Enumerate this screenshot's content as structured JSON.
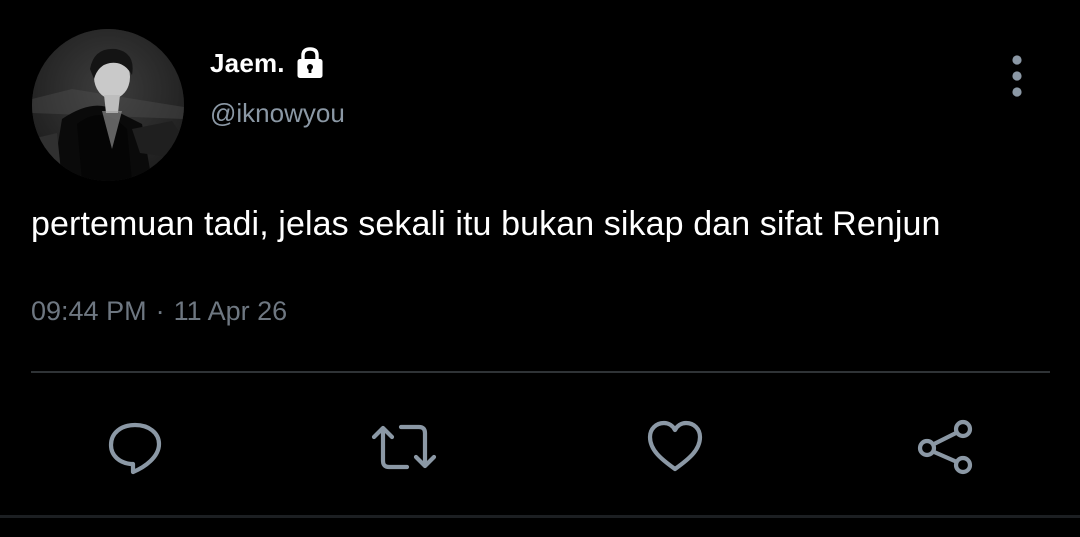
{
  "tweet": {
    "display_name": "Jaem.",
    "handle": "@iknowyou",
    "text": "pertemuan tadi, jelas sekali itu bukan sikap dan sifat Renjun",
    "time": "09:44 PM",
    "separator": "·",
    "date": "11 Apr 26",
    "protected_account": true
  },
  "icons": {
    "lock": "lock-icon",
    "more": "more-vertical-icon",
    "reply": "reply-icon",
    "retweet": "retweet-icon",
    "like": "heart-icon",
    "share": "share-icon"
  },
  "colors": {
    "background": "#000000",
    "primary_text": "#ffffff",
    "secondary_text": "#8b98a5",
    "timestamp_text": "#6e7781",
    "icon": "#8b98a5",
    "divider": "#2f3336"
  }
}
